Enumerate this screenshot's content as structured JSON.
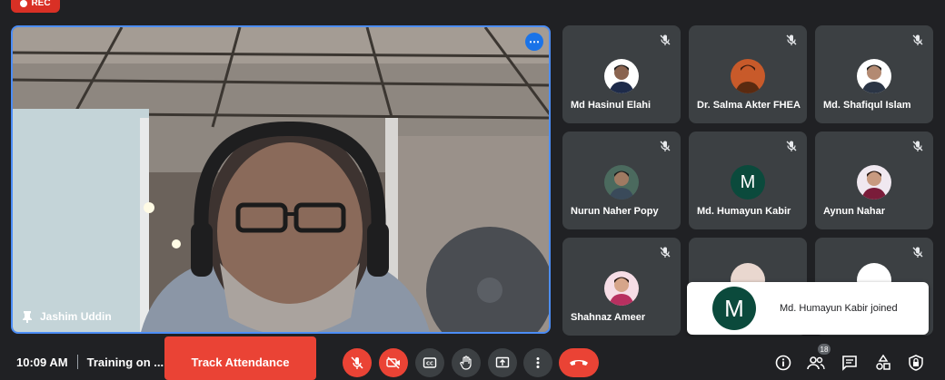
{
  "recording": {
    "label": "REC"
  },
  "main_tile": {
    "name": "Jashim Uddin"
  },
  "participants": [
    {
      "name": "Md Hasinul Elahi",
      "avatar": "photo"
    },
    {
      "name": "Dr. Salma Akter FHEA",
      "avatar": "photo"
    },
    {
      "name": "Md. Shafiqul Islam",
      "avatar": "photo"
    },
    {
      "name": "Nurun Naher Popy",
      "avatar": "photo"
    },
    {
      "name": "Md. Humayun Kabir",
      "avatar": "M"
    },
    {
      "name": "Aynun Nahar",
      "avatar": "photo"
    },
    {
      "name": "Shahnaz Ameer",
      "avatar": "photo"
    }
  ],
  "toast": {
    "avatar_letter": "M",
    "message": "Md. Humayun Kabir joined"
  },
  "bottom_bar": {
    "time": "10:09 AM",
    "meeting_title": "Training on ...",
    "track_attendance": "Track Attendance",
    "people_count": "18"
  },
  "colors": {
    "accent": "#1a73e8",
    "danger": "#ea4335",
    "tile_bg": "#3c4043",
    "page_bg": "#202124"
  },
  "icons": [
    "mic-off-icon",
    "camera-off-icon",
    "captions-icon",
    "raise-hand-icon",
    "present-icon",
    "more-vert-icon",
    "end-call-icon",
    "info-icon",
    "people-icon",
    "chat-icon",
    "activities-icon",
    "host-controls-icon",
    "pin-icon"
  ]
}
